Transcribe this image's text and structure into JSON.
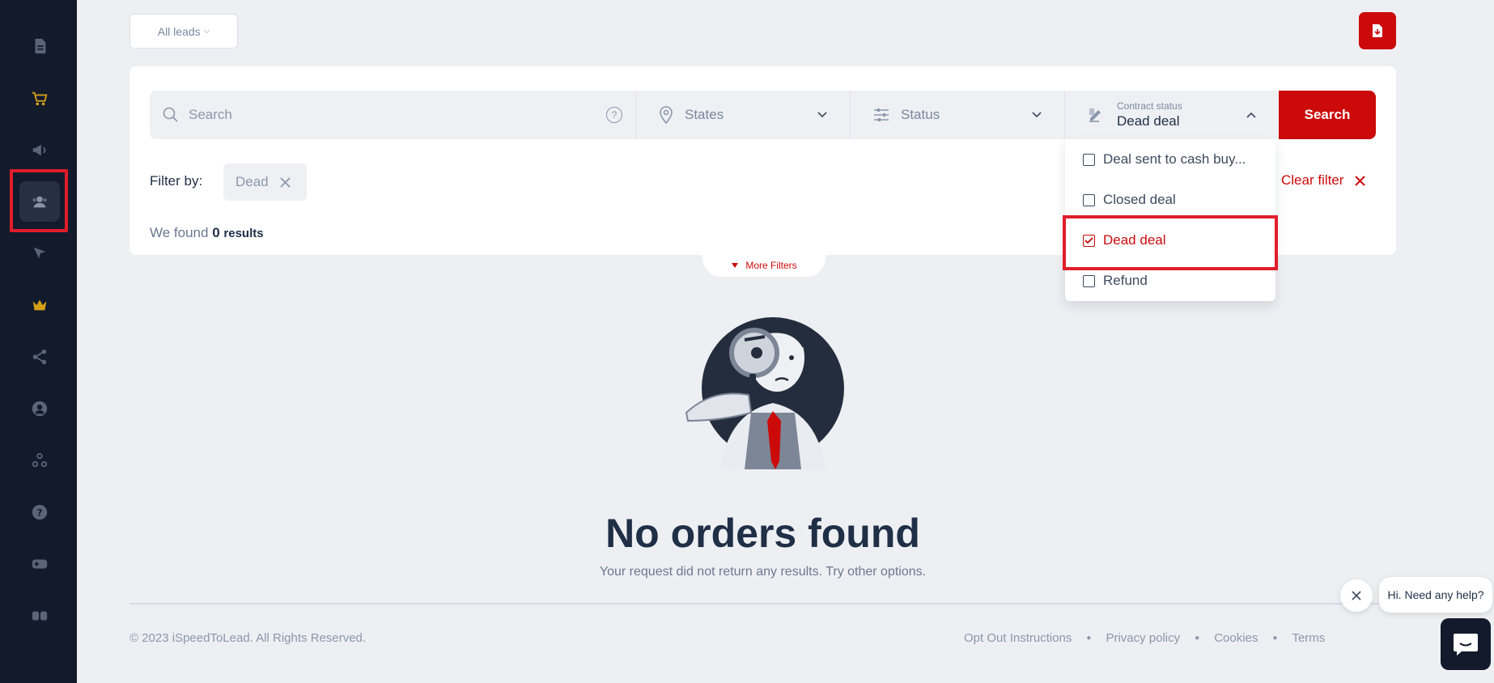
{
  "sidebar": {
    "items": [
      {
        "icon": "document-icon"
      },
      {
        "icon": "cart-icon"
      },
      {
        "icon": "megaphone-icon"
      },
      {
        "icon": "users-icon"
      },
      {
        "icon": "cursor-icon"
      },
      {
        "icon": "crown-icon"
      },
      {
        "icon": "share-icon"
      },
      {
        "icon": "user-circle-icon"
      },
      {
        "icon": "network-icon"
      },
      {
        "icon": "help-icon"
      },
      {
        "icon": "add-module-icon"
      },
      {
        "icon": "modules-icon"
      }
    ]
  },
  "top": {
    "leads_label": "All leads",
    "export_icon": "file-download-icon"
  },
  "filters": {
    "search_placeholder": "Search",
    "states_label": "States",
    "status_label": "Status",
    "contract_small_label": "Contract status",
    "contract_value": "Dead deal",
    "search_button": "Search",
    "filter_by_label": "Filter by:",
    "chip_label": "Dead",
    "clear_filter_label": "Clear filter",
    "results_prefix": "We found",
    "results_count": "0",
    "results_suffix": "results",
    "more_filters_label": "More Filters"
  },
  "dropdown": {
    "options": [
      {
        "label": "Deal sent to cash buy...",
        "checked": false
      },
      {
        "label": "Closed deal",
        "checked": false
      },
      {
        "label": "Dead deal",
        "checked": true
      },
      {
        "label": "Refund",
        "checked": false
      }
    ]
  },
  "empty": {
    "title": "No orders found",
    "subtitle": "Your request did not return any results. Try other options."
  },
  "footer": {
    "copyright": "© 2023 iSpeedToLead. All Rights Reserved.",
    "links": [
      "Opt Out Instructions",
      "Privacy policy",
      "Cookies",
      "Terms"
    ]
  },
  "chat": {
    "bubble_text": "Hi. Need any help?"
  },
  "colors": {
    "accent": "#cc0a0a",
    "sidebar_bg": "#121a2c",
    "page_bg": "#eeeff3"
  }
}
